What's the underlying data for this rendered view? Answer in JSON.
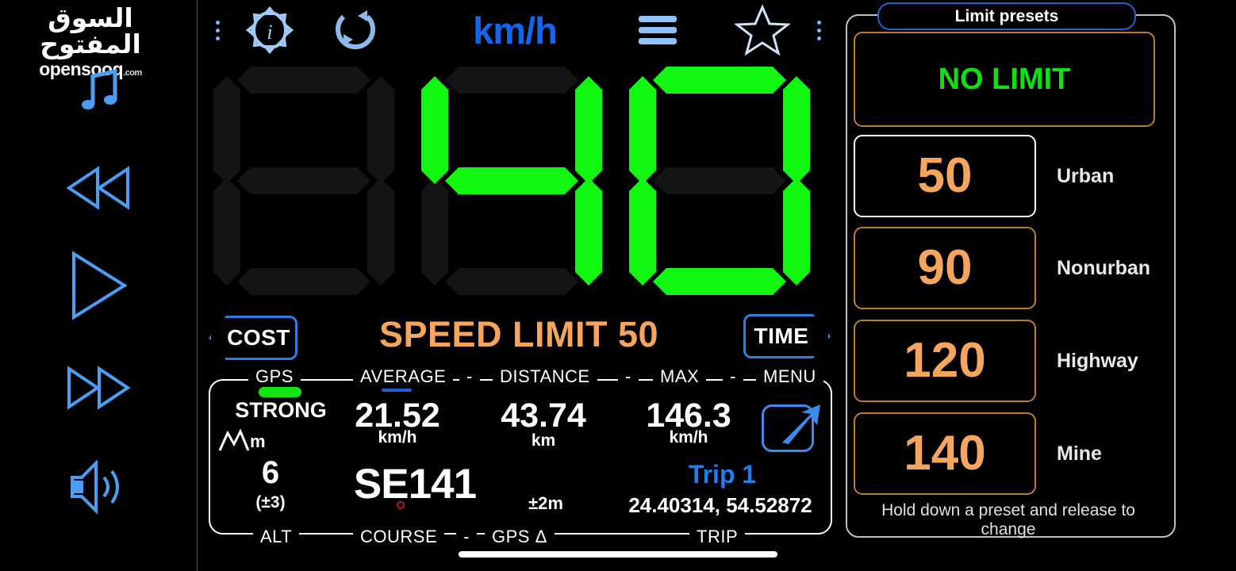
{
  "watermark": {
    "arabic": "السوق المفتوح",
    "english": "opensooq",
    "domain": ".com"
  },
  "left_rail": {
    "items": [
      {
        "name": "music-note-icon",
        "label": "Music"
      },
      {
        "name": "rewind-icon",
        "label": "Previous"
      },
      {
        "name": "play-icon",
        "label": "Play"
      },
      {
        "name": "fast-forward-icon",
        "label": "Next"
      },
      {
        "name": "volume-icon",
        "label": "Volume"
      }
    ]
  },
  "toolbar": {
    "unit_label": "km/h",
    "info_label": "Info settings",
    "reset_label": "Reset",
    "menu_label": "Menu",
    "favorite_label": "Favorite",
    "overflow_label": "More options"
  },
  "speedometer": {
    "digits": [
      "",
      "4",
      "0"
    ],
    "value": "40",
    "unit": "km/h",
    "on_color": "#12f712",
    "off_color": "#141414"
  },
  "controls": {
    "cost_label": "COST",
    "time_label": "TIME",
    "speed_limit_text": "SPEED LIMIT 50",
    "speed_limit_color": "#f5a55c"
  },
  "info_panel": {
    "gps": {
      "header": "GPS",
      "status": "STRONG",
      "status_color": "#14e414"
    },
    "altitude": {
      "unit": "m",
      "value": "6",
      "accuracy": "(±3)",
      "footer": "ALT"
    },
    "average": {
      "header": "AVERAGE",
      "value": "21.52",
      "unit": "km/h"
    },
    "distance": {
      "header": "DISTANCE",
      "value": "43.74",
      "unit": "km"
    },
    "max": {
      "header": "MAX",
      "value": "146.3",
      "unit": "km/h"
    },
    "menu": {
      "header": "MENU"
    },
    "course": {
      "value": "SE141",
      "footer": "COURSE"
    },
    "gps_delta": {
      "value": "±2m",
      "footer": "GPS Δ"
    },
    "trip": {
      "name": "Trip 1",
      "coords": "24.40314, 54.52872",
      "footer": "TRIP"
    },
    "separators": [
      "-",
      "-",
      "-",
      "-",
      "-"
    ]
  },
  "limit_presets": {
    "title": "Limit presets",
    "no_limit_label": "NO LIMIT",
    "no_limit_color": "#10e010",
    "items": [
      {
        "value": "50",
        "label": "Urban",
        "selected": true
      },
      {
        "value": "90",
        "label": "Nonurban",
        "selected": false
      },
      {
        "value": "120",
        "label": "Highway",
        "selected": false
      },
      {
        "value": "140",
        "label": "Mine",
        "selected": false
      }
    ],
    "hint": "Hold down a preset and release to change"
  }
}
